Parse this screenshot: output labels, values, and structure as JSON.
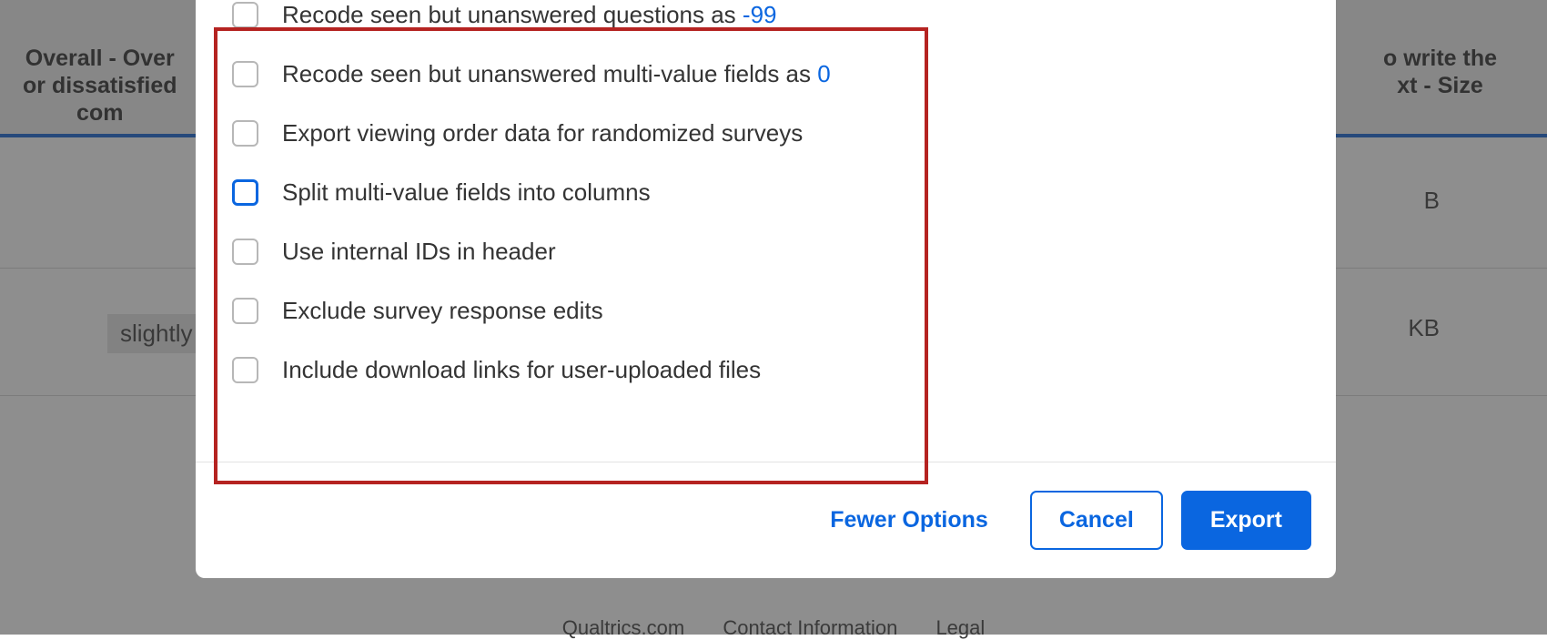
{
  "background": {
    "header_left": "Overall - Over\nor dissatisfied\ncom",
    "header_right": "o write the\nxt - Size",
    "rows": [
      {
        "right": "B"
      },
      {
        "left": "slightly",
        "right": "KB"
      },
      {
        "right": ""
      }
    ],
    "footer": [
      "Qualtrics.com",
      "Contact Information",
      "Legal"
    ]
  },
  "modal": {
    "options": [
      {
        "label_prefix": "Recode seen but unanswered questions as",
        "value": "-99",
        "focused": false
      },
      {
        "label_prefix": "Recode seen but unanswered multi-value fields as",
        "value": "0",
        "focused": false
      },
      {
        "label_prefix": "Export viewing order data for randomized surveys",
        "value": "",
        "focused": false
      },
      {
        "label_prefix": "Split multi-value fields into columns",
        "value": "",
        "focused": true
      },
      {
        "label_prefix": "Use internal IDs in header",
        "value": "",
        "focused": false
      },
      {
        "label_prefix": "Exclude survey response edits",
        "value": "",
        "focused": false
      },
      {
        "label_prefix": "Include download links for user-uploaded files",
        "value": "",
        "focused": false
      }
    ],
    "footer": {
      "fewer_options": "Fewer Options",
      "cancel": "Cancel",
      "export": "Export"
    }
  }
}
